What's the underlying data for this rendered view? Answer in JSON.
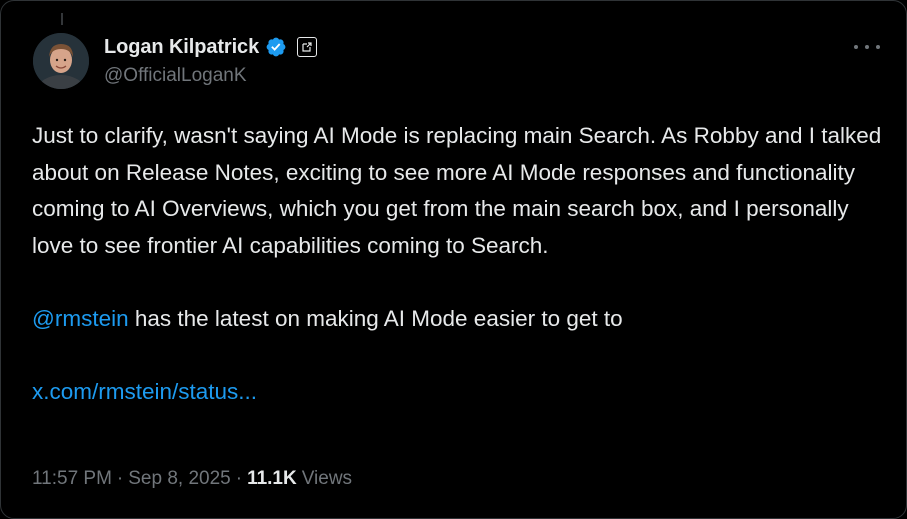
{
  "author": {
    "display_name": "Logan Kilpatrick",
    "handle": "@OfficialLoganK"
  },
  "tweet": {
    "paragraph1": "Just to clarify, wasn't saying AI Mode is replacing main Search. As Robby and I talked about on Release Notes, exciting to see more AI Mode responses and functionality coming to AI Overviews, which you get from the main search box, and I personally love to see frontier AI capabilities coming to Search.",
    "mention": "@rmstein",
    "paragraph2_rest": " has the latest on making AI Mode easier to get to",
    "link": "x.com/rmstein/status..."
  },
  "meta": {
    "time": "11:57 PM",
    "separator": "·",
    "date": "Sep 8, 2025",
    "views_count": "11.1K",
    "views_label": "Views"
  },
  "icons": {
    "verified": "verified-badge-icon",
    "label": "affiliate-label-icon",
    "more": "more-options-icon"
  },
  "colors": {
    "background": "#000000",
    "text": "#e7e9ea",
    "secondary_text": "#71767b",
    "link": "#1d9bf0",
    "verified": "#1d9bf0"
  }
}
